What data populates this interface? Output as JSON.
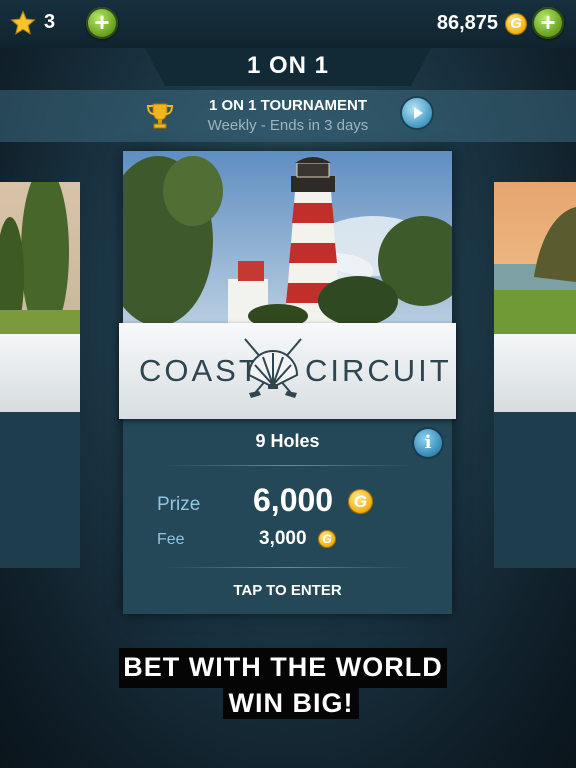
{
  "top_bar": {
    "stars_count": "3",
    "coin_balance": "86,875",
    "coin_symbol": "G"
  },
  "screen_title": "1 ON 1",
  "tournament": {
    "title": "1 ON 1 TOURNAMENT",
    "subtitle": "Weekly - Ends in 3 days"
  },
  "course_card": {
    "course_name_left": "COAST",
    "course_name_right": "CIRCUIT",
    "holes": "9 Holes",
    "info_symbol": "i",
    "prize_label": "Prize",
    "prize_value": "6,000",
    "fee_label": "Fee",
    "fee_value": "3,000",
    "enter_label": "TAP TO ENTER"
  },
  "promo": {
    "line1": "BET WITH THE WORLD",
    "line2": "WIN BIG!"
  },
  "colors": {
    "accent_green": "#6aa222",
    "coin_gold": "#f2b51c",
    "label_blue": "#8fc7e3"
  }
}
